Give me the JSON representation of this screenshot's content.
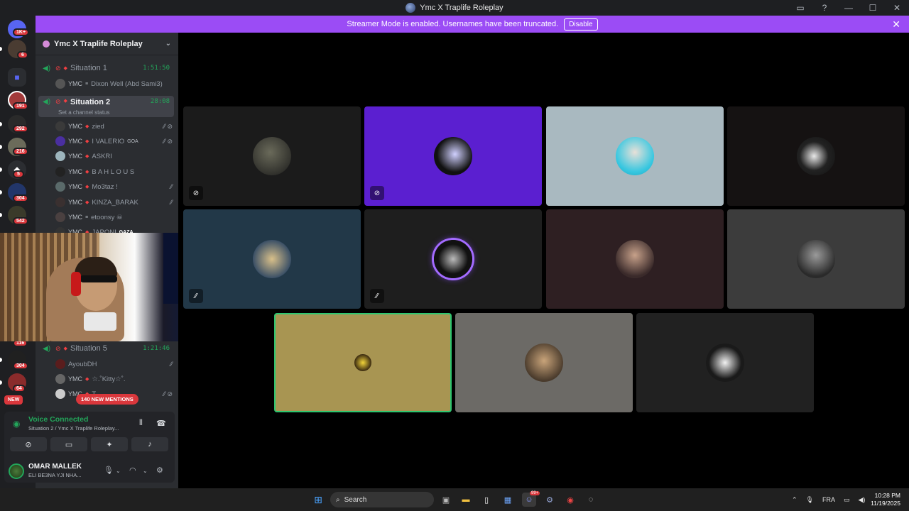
{
  "window": {
    "title": "Ymc X Traplife Roleplay"
  },
  "banner": {
    "text": "Streamer Mode is enabled. Usernames have been truncated.",
    "button": "Disable"
  },
  "guilds": {
    "badges": [
      "1K+",
      "6",
      "191",
      "292",
      "216",
      "5",
      "304",
      "542",
      "116",
      "304",
      "64"
    ],
    "new_label": "NEW"
  },
  "server": {
    "name": "Ymc X Traplife Roleplay"
  },
  "channels": [
    {
      "name": "Situation 1",
      "timer": "1:51:50"
    },
    {
      "name": "Situation 2",
      "timer": "28:08",
      "status": "Set a channel status"
    },
    {
      "name": "Situation 5",
      "timer": "1:21:46"
    }
  ],
  "members_sit1": [
    {
      "tag": "YMC",
      "name": "Dixon Well (Abd Sami3)"
    }
  ],
  "members_sit2": [
    {
      "tag": "YMC",
      "name": "zied"
    },
    {
      "tag": "YMC",
      "name": "I VALERIO",
      "extra": "GOA"
    },
    {
      "tag": "YMC",
      "name": "ASKRI"
    },
    {
      "tag": "YMC",
      "name": "B A H L O U S"
    },
    {
      "tag": "YMC",
      "name": "Mo3taz !"
    },
    {
      "tag": "YMC",
      "name": "KINZA_BARAK"
    },
    {
      "tag": "YMC",
      "name": "etoonsy ☠"
    },
    {
      "tag": "YMC",
      "name": "JAPONI",
      "extra": "GAZA"
    }
  ],
  "members_sit5": [
    {
      "tag": "",
      "name": "AyoubDH"
    },
    {
      "tag": "YMC",
      "name": "☆.˚Kitty☆˚."
    },
    {
      "tag": "YMC",
      "name": "T..."
    }
  ],
  "mentions": {
    "label": "140 NEW MENTIONS"
  },
  "voice": {
    "title": "Voice Connected",
    "subtitle": "Situation 2 / Ymc X Traplife Roleplay..."
  },
  "user": {
    "name": "OMAR MALLEK",
    "status": "ELI BE3NA YJI NHA..."
  },
  "taskbar": {
    "search_placeholder": "Search",
    "lang": "FRA",
    "time": "10:28 PM",
    "date": "11/19/2025",
    "discord_badge": "99+"
  },
  "colors": {
    "accent": "#9b4cf5",
    "online": "#23a55a",
    "danger": "#da373c",
    "tiles": [
      "#1b1b1b",
      "#5b1fd0",
      "#a9b9c0",
      "#151212",
      "#223848",
      "#1e1e1e",
      "#2e1f22",
      "#3c3c3c",
      "#a89552",
      "#6c6a66",
      "#212121"
    ]
  }
}
